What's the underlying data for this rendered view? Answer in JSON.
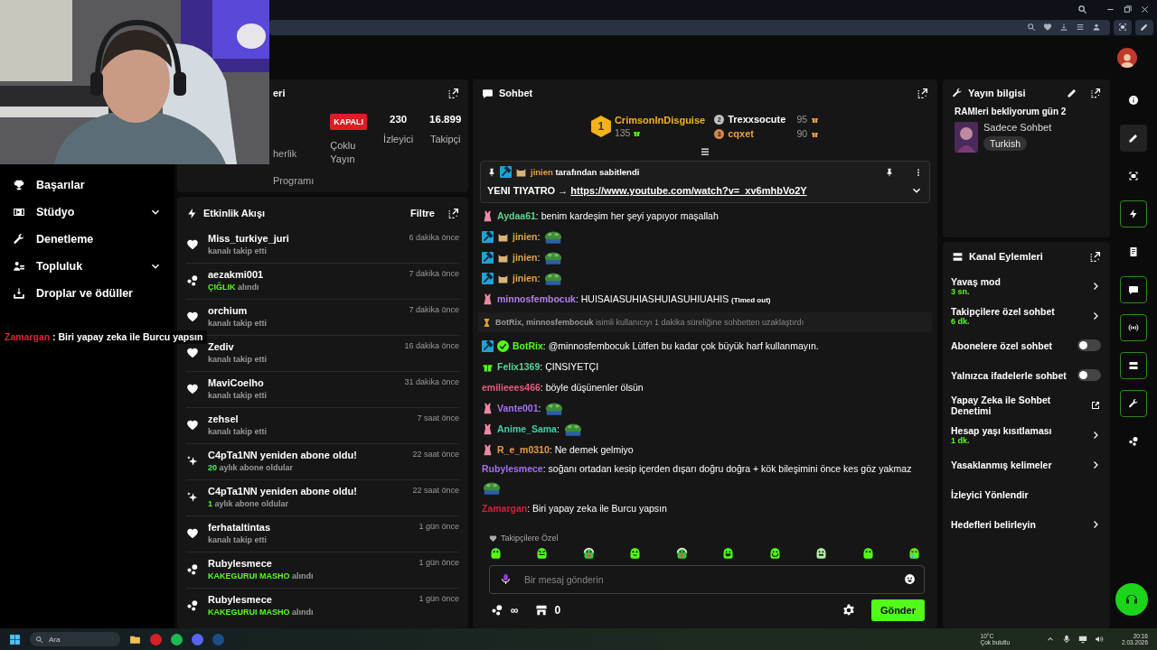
{
  "overlay_chat": {
    "user": "Zamargan",
    "color": "#e0203a",
    "text": " : Biri yapay zeka ile Burcu yapsın"
  },
  "sidebar": {
    "items": [
      {
        "label": "Başarılar",
        "expandable": false
      },
      {
        "label": "Stüdyo",
        "expandable": true
      },
      {
        "label": "Denetleme",
        "expandable": false
      },
      {
        "label": "Topluluk",
        "expandable": true
      },
      {
        "label": "Droplar ve ödüller",
        "expandable": false
      }
    ]
  },
  "stream_stats": {
    "title": "eri",
    "program_lines": [
      "herlik",
      "Programı"
    ],
    "multistream": {
      "badge": "KAPALI",
      "label": "Çoklu Yayın"
    },
    "stats": [
      {
        "value": "230",
        "label": "İzleyici"
      },
      {
        "value": "16.899",
        "label": "Takipçi"
      }
    ]
  },
  "activity": {
    "title": "Etkinlik Akışı",
    "filter": "Filtre",
    "rows": [
      {
        "kind": "follow",
        "name": "Miss_turkiye_juri",
        "detail": "kanalı takip etti",
        "time": "6 dakika önce"
      },
      {
        "kind": "reward",
        "name": "aezakmi001",
        "highlight": "ÇIĞLIK",
        "detail": " alındı",
        "time": "7 dakika önce"
      },
      {
        "kind": "follow",
        "name": "orchium",
        "detail": "kanalı takip etti",
        "time": "7 dakika önce"
      },
      {
        "kind": "follow",
        "name": "Zediv",
        "detail": "kanalı takip etti",
        "time": "16 dakika önce"
      },
      {
        "kind": "follow",
        "name": "MaviCoelho",
        "detail": "kanalı takip etti",
        "time": "31 dakika önce"
      },
      {
        "kind": "follow",
        "name": "zehsel",
        "detail": "kanalı takip etti",
        "time": "7 saat önce"
      },
      {
        "kind": "resub",
        "name": "C4pTa1NN yeniden abone oldu!",
        "highlight": "20",
        "detail": " aylık abone oldular",
        "time": "22 saat önce"
      },
      {
        "kind": "resub",
        "name": "C4pTa1NN yeniden abone oldu!",
        "highlight": "1",
        "detail": " aylık abone oldular",
        "time": "22 saat önce"
      },
      {
        "kind": "follow",
        "name": "ferhataltintas",
        "detail": "kanalı takip etti",
        "time": "1 gün önce"
      },
      {
        "kind": "reward",
        "name": "Rubylesmece",
        "highlight": "KAKEGURUI MASHO",
        "detail": " alındı",
        "time": "1 gün önce"
      },
      {
        "kind": "reward",
        "name": "Rubylesmece",
        "highlight": "KAKEGURUI MASHO",
        "detail": " alındı",
        "time": "1 gün önce"
      }
    ]
  },
  "chat": {
    "title": "Sohbet",
    "leaders": [
      {
        "rank": "1",
        "name": "CrimsonInDisguise",
        "count": "135"
      },
      {
        "rank": "2",
        "name": "Trexxsocute",
        "count": "95"
      },
      {
        "rank": "3",
        "name": "cqxet",
        "count": "90"
      }
    ],
    "pinned": {
      "by": "jinien",
      "by_text": "tarafından sabitlendi",
      "text": "YENI TIYATRO → ",
      "link": "https://www.youtube.com/watch?v=_xv6mhbVo2Y"
    },
    "messages": [
      {
        "kind": "message",
        "badges": [
          {
            "kind": "figure"
          }
        ],
        "user": "Aydaa61",
        "color": "#5fd38d",
        "text": ": benim kardeşim her şeyi yapıyor maşallah",
        "emote": false
      },
      {
        "kind": "message",
        "badges": [
          {
            "kind": "mod"
          },
          {
            "kind": "sub"
          }
        ],
        "user": "jinien",
        "color": "#e8a33d",
        "text": ":",
        "emote": true
      },
      {
        "kind": "message",
        "badges": [
          {
            "kind": "mod"
          },
          {
            "kind": "sub"
          }
        ],
        "user": "jinien",
        "color": "#e8a33d",
        "text": ":",
        "emote": true
      },
      {
        "kind": "message",
        "badges": [
          {
            "kind": "mod"
          },
          {
            "kind": "sub"
          }
        ],
        "user": "jinien",
        "color": "#e8a33d",
        "text": ":",
        "emote": true
      },
      {
        "kind": "message",
        "badges": [
          {
            "kind": "figure"
          }
        ],
        "user": "minnosfembocuk",
        "color": "#b57ee8",
        "text": ": HUISAIASUHIASHUIASUHIUAHIS",
        "note": "(Timed out)",
        "emote": false
      },
      {
        "kind": "notice",
        "user": "BotRix, minnosfembocuk",
        "text": " isimli kullanıcıyı 1 dakika süreliğine sohbetten uzaklaştırdı"
      },
      {
        "kind": "message",
        "badges": [
          {
            "kind": "mod"
          },
          {
            "kind": "verified"
          }
        ],
        "user": "BotRix",
        "color": "#53fc18",
        "text": ": @minnosfembocuk Lütfen bu kadar çok büyük harf kullanmayın.",
        "emote": false
      },
      {
        "kind": "message",
        "badges": [
          {
            "kind": "gift"
          }
        ],
        "user": "Felix1369",
        "color": "#56d49a",
        "text": ": ÇINSIYETÇI",
        "emote": false
      },
      {
        "kind": "message",
        "user": "emilieees466",
        "color": "#e0607e",
        "text": ": böyle düşünenler ölsün",
        "emote": false
      },
      {
        "kind": "message",
        "badges": [
          {
            "kind": "figure"
          }
        ],
        "user": "Vante001",
        "color": "#a56ff0",
        "text": ":",
        "emote": true
      },
      {
        "kind": "message",
        "badges": [
          {
            "kind": "figure"
          }
        ],
        "user": "Anime_Sama",
        "color": "#3fd0a8",
        "text": ":",
        "emote": true
      },
      {
        "kind": "message",
        "badges": [
          {
            "kind": "figure"
          }
        ],
        "user": "R_e_m0310",
        "color": "#ef9a3a",
        "text": ": Ne demek gelmiyo",
        "emote": false
      },
      {
        "kind": "message",
        "user": "Rubylesmece",
        "color": "#a56ff0",
        "text": ": soğanı ortadan kesip içerden dışarı doğru doğra + kök bileşimini önce kes göz yakmaz",
        "emote": true
      },
      {
        "kind": "message",
        "user": "Zamargan",
        "color": "#d81e3a",
        "text": ": Biri yapay zeka ile Burcu yapsın",
        "emote": false
      }
    ],
    "followers_label": "Takipçilere Özel",
    "emotes": [
      {
        "kind": "blob"
      },
      {
        "kind": "angry"
      },
      {
        "kind": "headset"
      },
      {
        "kind": "wink"
      },
      {
        "kind": "headset"
      },
      {
        "kind": "grin"
      },
      {
        "kind": "smile"
      },
      {
        "kind": "skull"
      },
      {
        "kind": "blob"
      },
      {
        "kind": "love"
      }
    ],
    "input": {
      "placeholder": "Bir mesaj gönderin"
    },
    "points": "∞",
    "store_count": "0",
    "send": "Gönder"
  },
  "stream_info": {
    "title": "Yayın bilgisi",
    "stream_title": "RAMleri bekliyorum gün 2",
    "category": "Sadece Sohbet",
    "tag": "Turkish"
  },
  "channel_actions": {
    "title": "Kanal Eylemleri",
    "items": [
      {
        "kind": "nav",
        "label": "Yavaş mod",
        "value": "3 sn."
      },
      {
        "kind": "nav",
        "label": "Takipçilere özel sohbet",
        "value": "6 dk."
      },
      {
        "kind": "toggle",
        "label": "Abonelere özel sohbet",
        "on": false
      },
      {
        "kind": "toggle",
        "label": "Yalnızca ifadelerle sohbet",
        "on": false
      },
      {
        "kind": "external",
        "label": "Yapay Zeka ile Sohbet Denetimi"
      },
      {
        "kind": "nav",
        "label": "Hesap yaşı kısıtlaması",
        "value": "1 dk."
      },
      {
        "kind": "nav",
        "label": "Yasaklanmış kelimeler"
      },
      {
        "kind": "plain",
        "label": "İzleyici Yönlendir"
      },
      {
        "kind": "nav",
        "label": "Hedefleri belirleyin"
      }
    ]
  },
  "rail": [
    {
      "kind": "plain"
    },
    {
      "kind": "filled"
    },
    {
      "kind": "plain"
    },
    {
      "kind": "outlined"
    },
    {
      "kind": "plain"
    },
    {
      "kind": "outlined"
    },
    {
      "kind": "outlined"
    },
    {
      "kind": "outlined"
    },
    {
      "kind": "outlined"
    },
    {
      "kind": "plain"
    }
  ],
  "taskbar": {
    "search": "Ara",
    "weather": {
      "temp": "10°C",
      "text": "Çok bulutlu"
    },
    "time": "20:16",
    "date": "2.03.2026"
  }
}
